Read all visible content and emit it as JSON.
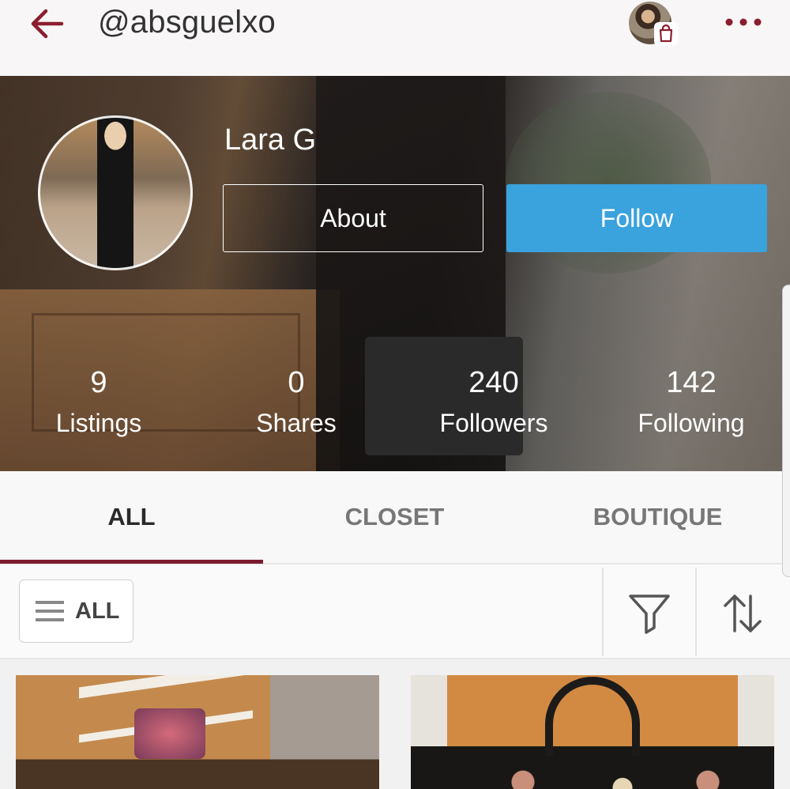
{
  "header": {
    "handle": "@absguelxo",
    "back_icon": "arrow-left-icon",
    "more_icon": "more-horizontal-icon",
    "accent": "#8b1e2f"
  },
  "profile": {
    "name": "Lara G",
    "about_label": "About",
    "follow_label": "Follow",
    "follow_color": "#3aa2dd"
  },
  "stats": [
    {
      "value": "9",
      "label": "Listings"
    },
    {
      "value": "0",
      "label": "Shares"
    },
    {
      "value": "240",
      "label": "Followers"
    },
    {
      "value": "142",
      "label": "Following"
    }
  ],
  "tabs": [
    {
      "label": "ALL",
      "active": true
    },
    {
      "label": "CLOSET",
      "active": false
    },
    {
      "label": "BOUTIQUE",
      "active": false
    }
  ],
  "filterbar": {
    "dropdown_label": "ALL",
    "filter_icon": "filter-icon",
    "sort_icon": "sort-icon"
  }
}
